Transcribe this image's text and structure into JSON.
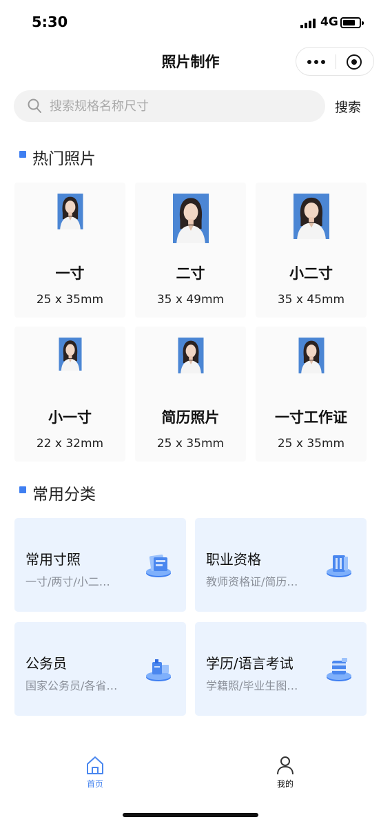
{
  "status_bar": {
    "time": "5:30",
    "network": "4G"
  },
  "header": {
    "title": "照片制作"
  },
  "search": {
    "placeholder": "搜索规格名称尺寸",
    "value": "",
    "button_label": "搜索"
  },
  "hot_section": {
    "title": "热门照片",
    "items": [
      {
        "name": "一寸",
        "size": "25 x 35mm"
      },
      {
        "name": "二寸",
        "size": "35 x 49mm"
      },
      {
        "name": "小二寸",
        "size": "35 x 45mm"
      },
      {
        "name": "小一寸",
        "size": "22 x 32mm"
      },
      {
        "name": "简历照片",
        "size": "25 x 35mm"
      },
      {
        "name": "一寸工作证",
        "size": "25 x 35mm"
      }
    ]
  },
  "category_section": {
    "title": "常用分类",
    "items": [
      {
        "title": "常用寸照",
        "desc": "一寸/两寸/小二…",
        "icon": "photo-stack-icon"
      },
      {
        "title": "职业资格",
        "desc": "教师资格证/简历…",
        "icon": "certificate-icon"
      },
      {
        "title": "公务员",
        "desc": "国家公务员/各省…",
        "icon": "badge-icon"
      },
      {
        "title": "学历/语言考试",
        "desc": "学籍照/毕业生图…",
        "icon": "graduation-icon"
      }
    ]
  },
  "tab_bar": {
    "items": [
      {
        "label": "首页",
        "icon": "home-icon",
        "active": true
      },
      {
        "label": "我的",
        "icon": "user-icon",
        "active": false
      }
    ]
  },
  "colors": {
    "accent": "#3f7ff1",
    "photo_bg": "#4b86d4",
    "card_bg": "#fafafa",
    "category_bg": "#ebf3fe"
  }
}
